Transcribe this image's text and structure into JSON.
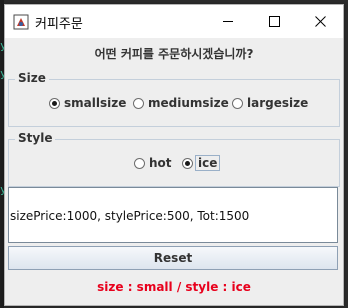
{
  "window": {
    "title": "커피주문",
    "controls": {
      "minimize": "minimize-icon",
      "maximize": "maximize-icon",
      "close": "close-icon"
    }
  },
  "question": "어떤 커피를 주문하시겠습니까?",
  "size_group": {
    "legend": "Size",
    "options": [
      {
        "label": "smallsize",
        "selected": true
      },
      {
        "label": "mediumsize",
        "selected": false
      },
      {
        "label": "largesize",
        "selected": false
      }
    ]
  },
  "style_group": {
    "legend": "Style",
    "options": [
      {
        "label": "hot",
        "selected": false
      },
      {
        "label": "ice",
        "selected": true
      }
    ]
  },
  "output_text": "sizePrice:1000, stylePrice:500, Tot:1500",
  "reset_label": "Reset",
  "status_text": "size : small / style : ice",
  "colors": {
    "status_text": "#e8001c",
    "group_border": "#c4cfdb",
    "window_bg": "#eeeeee"
  }
}
